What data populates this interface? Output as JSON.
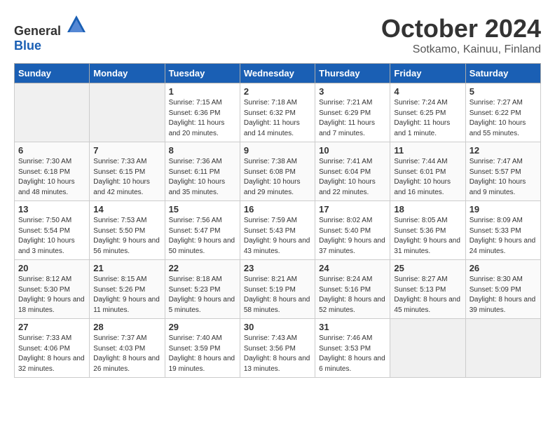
{
  "header": {
    "logo_general": "General",
    "logo_blue": "Blue",
    "month": "October 2024",
    "location": "Sotkamo, Kainuu, Finland"
  },
  "weekdays": [
    "Sunday",
    "Monday",
    "Tuesday",
    "Wednesday",
    "Thursday",
    "Friday",
    "Saturday"
  ],
  "weeks": [
    [
      {
        "day": "",
        "empty": true
      },
      {
        "day": "",
        "empty": true
      },
      {
        "day": "1",
        "sunrise": "Sunrise: 7:15 AM",
        "sunset": "Sunset: 6:36 PM",
        "daylight": "Daylight: 11 hours and 20 minutes."
      },
      {
        "day": "2",
        "sunrise": "Sunrise: 7:18 AM",
        "sunset": "Sunset: 6:32 PM",
        "daylight": "Daylight: 11 hours and 14 minutes."
      },
      {
        "day": "3",
        "sunrise": "Sunrise: 7:21 AM",
        "sunset": "Sunset: 6:29 PM",
        "daylight": "Daylight: 11 hours and 7 minutes."
      },
      {
        "day": "4",
        "sunrise": "Sunrise: 7:24 AM",
        "sunset": "Sunset: 6:25 PM",
        "daylight": "Daylight: 11 hours and 1 minute."
      },
      {
        "day": "5",
        "sunrise": "Sunrise: 7:27 AM",
        "sunset": "Sunset: 6:22 PM",
        "daylight": "Daylight: 10 hours and 55 minutes."
      }
    ],
    [
      {
        "day": "6",
        "sunrise": "Sunrise: 7:30 AM",
        "sunset": "Sunset: 6:18 PM",
        "daylight": "Daylight: 10 hours and 48 minutes."
      },
      {
        "day": "7",
        "sunrise": "Sunrise: 7:33 AM",
        "sunset": "Sunset: 6:15 PM",
        "daylight": "Daylight: 10 hours and 42 minutes."
      },
      {
        "day": "8",
        "sunrise": "Sunrise: 7:36 AM",
        "sunset": "Sunset: 6:11 PM",
        "daylight": "Daylight: 10 hours and 35 minutes."
      },
      {
        "day": "9",
        "sunrise": "Sunrise: 7:38 AM",
        "sunset": "Sunset: 6:08 PM",
        "daylight": "Daylight: 10 hours and 29 minutes."
      },
      {
        "day": "10",
        "sunrise": "Sunrise: 7:41 AM",
        "sunset": "Sunset: 6:04 PM",
        "daylight": "Daylight: 10 hours and 22 minutes."
      },
      {
        "day": "11",
        "sunrise": "Sunrise: 7:44 AM",
        "sunset": "Sunset: 6:01 PM",
        "daylight": "Daylight: 10 hours and 16 minutes."
      },
      {
        "day": "12",
        "sunrise": "Sunrise: 7:47 AM",
        "sunset": "Sunset: 5:57 PM",
        "daylight": "Daylight: 10 hours and 9 minutes."
      }
    ],
    [
      {
        "day": "13",
        "sunrise": "Sunrise: 7:50 AM",
        "sunset": "Sunset: 5:54 PM",
        "daylight": "Daylight: 10 hours and 3 minutes."
      },
      {
        "day": "14",
        "sunrise": "Sunrise: 7:53 AM",
        "sunset": "Sunset: 5:50 PM",
        "daylight": "Daylight: 9 hours and 56 minutes."
      },
      {
        "day": "15",
        "sunrise": "Sunrise: 7:56 AM",
        "sunset": "Sunset: 5:47 PM",
        "daylight": "Daylight: 9 hours and 50 minutes."
      },
      {
        "day": "16",
        "sunrise": "Sunrise: 7:59 AM",
        "sunset": "Sunset: 5:43 PM",
        "daylight": "Daylight: 9 hours and 43 minutes."
      },
      {
        "day": "17",
        "sunrise": "Sunrise: 8:02 AM",
        "sunset": "Sunset: 5:40 PM",
        "daylight": "Daylight: 9 hours and 37 minutes."
      },
      {
        "day": "18",
        "sunrise": "Sunrise: 8:05 AM",
        "sunset": "Sunset: 5:36 PM",
        "daylight": "Daylight: 9 hours and 31 minutes."
      },
      {
        "day": "19",
        "sunrise": "Sunrise: 8:09 AM",
        "sunset": "Sunset: 5:33 PM",
        "daylight": "Daylight: 9 hours and 24 minutes."
      }
    ],
    [
      {
        "day": "20",
        "sunrise": "Sunrise: 8:12 AM",
        "sunset": "Sunset: 5:30 PM",
        "daylight": "Daylight: 9 hours and 18 minutes."
      },
      {
        "day": "21",
        "sunrise": "Sunrise: 8:15 AM",
        "sunset": "Sunset: 5:26 PM",
        "daylight": "Daylight: 9 hours and 11 minutes."
      },
      {
        "day": "22",
        "sunrise": "Sunrise: 8:18 AM",
        "sunset": "Sunset: 5:23 PM",
        "daylight": "Daylight: 9 hours and 5 minutes."
      },
      {
        "day": "23",
        "sunrise": "Sunrise: 8:21 AM",
        "sunset": "Sunset: 5:19 PM",
        "daylight": "Daylight: 8 hours and 58 minutes."
      },
      {
        "day": "24",
        "sunrise": "Sunrise: 8:24 AM",
        "sunset": "Sunset: 5:16 PM",
        "daylight": "Daylight: 8 hours and 52 minutes."
      },
      {
        "day": "25",
        "sunrise": "Sunrise: 8:27 AM",
        "sunset": "Sunset: 5:13 PM",
        "daylight": "Daylight: 8 hours and 45 minutes."
      },
      {
        "day": "26",
        "sunrise": "Sunrise: 8:30 AM",
        "sunset": "Sunset: 5:09 PM",
        "daylight": "Daylight: 8 hours and 39 minutes."
      }
    ],
    [
      {
        "day": "27",
        "sunrise": "Sunrise: 7:33 AM",
        "sunset": "Sunset: 4:06 PM",
        "daylight": "Daylight: 8 hours and 32 minutes."
      },
      {
        "day": "28",
        "sunrise": "Sunrise: 7:37 AM",
        "sunset": "Sunset: 4:03 PM",
        "daylight": "Daylight: 8 hours and 26 minutes."
      },
      {
        "day": "29",
        "sunrise": "Sunrise: 7:40 AM",
        "sunset": "Sunset: 3:59 PM",
        "daylight": "Daylight: 8 hours and 19 minutes."
      },
      {
        "day": "30",
        "sunrise": "Sunrise: 7:43 AM",
        "sunset": "Sunset: 3:56 PM",
        "daylight": "Daylight: 8 hours and 13 minutes."
      },
      {
        "day": "31",
        "sunrise": "Sunrise: 7:46 AM",
        "sunset": "Sunset: 3:53 PM",
        "daylight": "Daylight: 8 hours and 6 minutes."
      },
      {
        "day": "",
        "empty": true
      },
      {
        "day": "",
        "empty": true
      }
    ]
  ]
}
